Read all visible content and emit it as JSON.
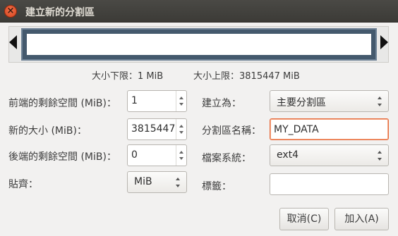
{
  "window": {
    "title": "建立新的分割區"
  },
  "limits": {
    "min": "大小下限：1 MiB",
    "max": "大小上限：3815447 MiB"
  },
  "left": {
    "free_before": {
      "label": "前端的剩餘空間 (MiB)：",
      "value": "1"
    },
    "new_size": {
      "label": "新的大小 (MiB)：",
      "value": "3815447"
    },
    "free_after": {
      "label": "後端的剩餘空間 (MiB)：",
      "value": "0"
    },
    "align": {
      "label": "貼齊：",
      "value": "MiB"
    }
  },
  "right": {
    "create_as": {
      "label": "建立為：",
      "value": "主要分割區"
    },
    "partition_name": {
      "label": "分割區名稱：",
      "value": "MY_DATA"
    },
    "filesystem": {
      "label": "檔案系統：",
      "value": "ext4"
    },
    "label_field": {
      "label": "標籤：",
      "value": ""
    }
  },
  "buttons": {
    "cancel": "取消(C)",
    "add": "加入(A)"
  },
  "icons": {
    "close": "close-icon",
    "resize_left": "arrow-left-icon",
    "resize_right": "arrow-right-icon"
  },
  "colors": {
    "partition": "#44596d",
    "titlebar": "#3c3b37",
    "close": "#e2542b",
    "focus": "#e66a3c"
  }
}
